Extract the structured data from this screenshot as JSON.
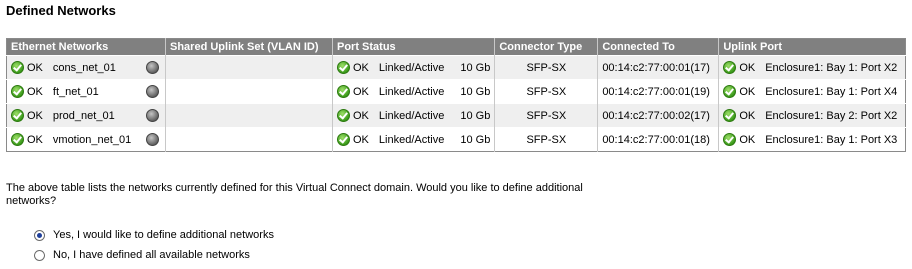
{
  "page": {
    "title": "Defined Networks"
  },
  "table": {
    "headers": [
      "Ethernet Networks",
      "Shared Uplink Set (VLAN ID)",
      "Port Status",
      "Connector Type",
      "Connected To",
      "Uplink Port"
    ],
    "rows": [
      {
        "net_status": "OK",
        "network": "cons_net_01",
        "shared_uplink": "",
        "port_status": "OK",
        "link": "Linked/Active",
        "speed": "10 Gb",
        "connector": "SFP-SX",
        "connected_to": "00:14:c2:77:00:01(17)",
        "uplink_status": "OK",
        "uplink_port": "Enclosure1: Bay 1: Port X2"
      },
      {
        "net_status": "OK",
        "network": "ft_net_01",
        "shared_uplink": "",
        "port_status": "OK",
        "link": "Linked/Active",
        "speed": "10 Gb",
        "connector": "SFP-SX",
        "connected_to": "00:14:c2:77:00:01(19)",
        "uplink_status": "OK",
        "uplink_port": "Enclosure1: Bay 1: Port X4"
      },
      {
        "net_status": "OK",
        "network": "prod_net_01",
        "shared_uplink": "",
        "port_status": "OK",
        "link": "Linked/Active",
        "speed": "10 Gb",
        "connector": "SFP-SX",
        "connected_to": "00:14:c2:77:00:02(17)",
        "uplink_status": "OK",
        "uplink_port": "Enclosure1: Bay 2: Port X2"
      },
      {
        "net_status": "OK",
        "network": "vmotion_net_01",
        "shared_uplink": "",
        "port_status": "OK",
        "link": "Linked/Active",
        "speed": "10 Gb",
        "connector": "SFP-SX",
        "connected_to": "00:14:c2:77:00:01(18)",
        "uplink_status": "OK",
        "uplink_port": "Enclosure1: Bay 1: Port X3"
      }
    ]
  },
  "question": "The above table lists the networks currently defined for this Virtual Connect domain. Would you like to define additional networks?",
  "options": [
    {
      "label": "Yes, I would like to define additional networks",
      "selected": true
    },
    {
      "label": "No, I have defined all available networks",
      "selected": false
    }
  ]
}
